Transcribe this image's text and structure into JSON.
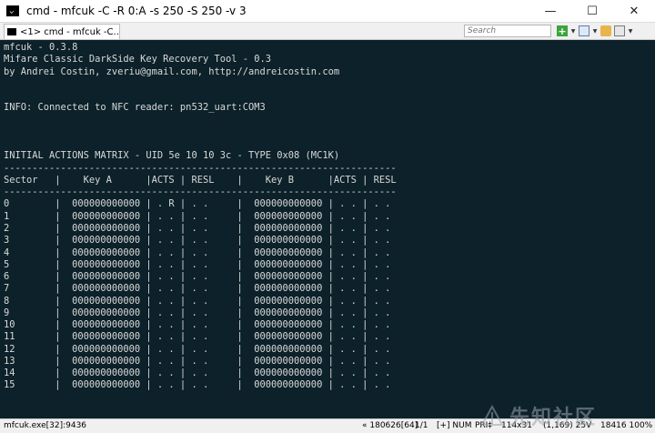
{
  "window": {
    "title": "cmd - mfcuk  -C -R 0:A -s 250 -S 250 -v 3",
    "controls": {
      "minimize": "—",
      "maximize": "☐",
      "close": "✕"
    }
  },
  "toolbar": {
    "tab_label": "<1>  cmd - mfcuk  -C...",
    "search_placeholder": "Search",
    "icons": [
      "add-console-icon",
      "dropdown-icon",
      "view-icon",
      "dropdown-icon",
      "lock-icon",
      "settings-icon",
      "dropdown-icon"
    ]
  },
  "console": {
    "lines": [
      "mfcuk - 0.3.8",
      "Mifare Classic DarkSide Key Recovery Tool - 0.3",
      "by Andrei Costin, zveriu@gmail.com, http://andreicostin.com",
      "",
      "",
      "INFO: Connected to NFC reader: pn532_uart:COM3",
      "",
      "",
      "",
      "INITIAL ACTIONS MATRIX - UID 5e 10 10 3c - TYPE 0x08 (MC1K)",
      "---------------------------------------------------------------------",
      "Sector   |    Key A      |ACTS | RESL    |    Key B      |ACTS | RESL",
      "---------------------------------------------------------------------",
      "0        |  000000000000 | . R | . .     |  000000000000 | . . | . .",
      "1        |  000000000000 | . . | . .     |  000000000000 | . . | . .",
      "2        |  000000000000 | . . | . .     |  000000000000 | . . | . .",
      "3        |  000000000000 | . . | . .     |  000000000000 | . . | . .",
      "4        |  000000000000 | . . | . .     |  000000000000 | . . | . .",
      "5        |  000000000000 | . . | . .     |  000000000000 | . . | . .",
      "6        |  000000000000 | . . | . .     |  000000000000 | . . | . .",
      "7        |  000000000000 | . . | . .     |  000000000000 | . . | . .",
      "8        |  000000000000 | . . | . .     |  000000000000 | . . | . .",
      "9        |  000000000000 | . . | . .     |  000000000000 | . . | . .",
      "10       |  000000000000 | . . | . .     |  000000000000 | . . | . .",
      "11       |  000000000000 | . . | . .     |  000000000000 | . . | . .",
      "12       |  000000000000 | . . | . .     |  000000000000 | . . | . .",
      "13       |  000000000000 | . . | . .     |  000000000000 | . . | . .",
      "14       |  000000000000 | . . | . .     |  000000000000 | . . | . .",
      "15       |  000000000000 | . . | . .     |  000000000000 | . . | . ."
    ]
  },
  "statusbar": {
    "process": "mfcuk.exe[32]:9436",
    "build": "« 180626[64]",
    "position": "1/1",
    "keys": "[+] NUM",
    "priority": "PRI‡",
    "size": "114x31",
    "cursor": "(1,169) 25V",
    "memory": "18416 100%"
  },
  "watermark": {
    "text": "先知社区"
  },
  "colors": {
    "console_bg": "#0c2129",
    "console_fg": "#d9d9d9"
  }
}
